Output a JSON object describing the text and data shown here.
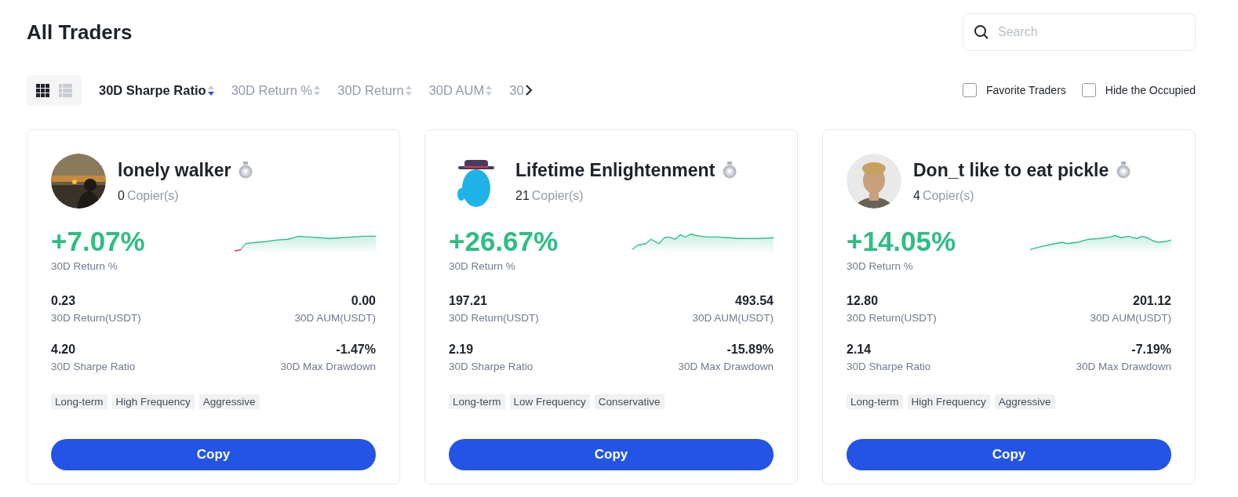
{
  "title": "All Traders",
  "search": {
    "placeholder": "Search"
  },
  "view_modes": [
    {
      "kind": "grid",
      "selected": true
    },
    {
      "kind": "list",
      "selected": false
    }
  ],
  "sort_options": [
    {
      "label": "30D Sharpe Ratio",
      "selected": true
    },
    {
      "label": "30D Return %",
      "selected": false
    },
    {
      "label": "30D Return",
      "selected": false
    },
    {
      "label": "30D AUM",
      "selected": false
    },
    {
      "label": "30",
      "selected": false
    }
  ],
  "filters": [
    {
      "label": "Favorite Traders",
      "checked": false
    },
    {
      "label": "Hide the Occupied",
      "checked": false
    }
  ],
  "traders": [
    {
      "name": "lonely walker",
      "avatar": {
        "kind": "picture"
      },
      "copiers": "0",
      "copiers_label": "Copier(s)",
      "return_pct": "+7.07%",
      "return_pct_label": "30D Return %",
      "stats": [
        {
          "value": "0.23",
          "label": "30D Return(USDT)"
        },
        {
          "value": "0.00",
          "label": "30D AUM(USDT)"
        },
        {
          "value": "4.20",
          "label": "30D Sharpe Ratio"
        },
        {
          "value": "-1.47%",
          "label": "30D Max Drawdown"
        }
      ],
      "tags": [
        "Long-term",
        "High Frequency",
        "Aggressive"
      ],
      "button": "Copy"
    },
    {
      "name": "Lifetime Enlightenment",
      "avatar": {
        "kind": "picture"
      },
      "copiers": "21",
      "copiers_label": "Copier(s)",
      "return_pct": "+26.67%",
      "return_pct_label": "30D Return %",
      "stats": [
        {
          "value": "197.21",
          "label": "30D Return(USDT)"
        },
        {
          "value": "493.54",
          "label": "30D AUM(USDT)"
        },
        {
          "value": "2.19",
          "label": "30D Sharpe Ratio"
        },
        {
          "value": "-15.89%",
          "label": "30D Max Drawdown"
        }
      ],
      "tags": [
        "Long-term",
        "Low Frequency",
        "Conservative"
      ],
      "button": "Copy"
    },
    {
      "name": "Don_t like to eat pickle",
      "avatar": {
        "kind": "picture"
      },
      "copiers": "4",
      "copiers_label": "Copier(s)",
      "return_pct": "+14.05%",
      "return_pct_label": "30D Return %",
      "stats": [
        {
          "value": "12.80",
          "label": "30D Return(USDT)"
        },
        {
          "value": "201.12",
          "label": "30D AUM(USDT)"
        },
        {
          "value": "2.14",
          "label": "30D Sharpe Ratio"
        },
        {
          "value": "-7.19%",
          "label": "30D Max Drawdown"
        }
      ],
      "tags": [
        "Long-term",
        "High Frequency",
        "Aggressive"
      ],
      "button": "Copy"
    }
  ]
}
